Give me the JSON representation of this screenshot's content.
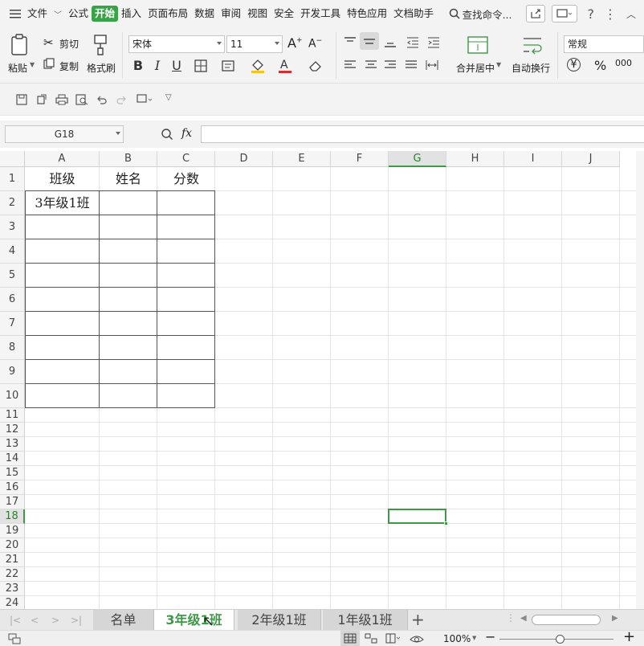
{
  "menu": {
    "items": [
      "文件",
      "公式",
      "开始",
      "插入",
      "页面布局",
      "数据",
      "审阅",
      "视图",
      "安全",
      "开发工具",
      "特色应用",
      "文档助手"
    ],
    "active": "开始",
    "search": "查找命令...",
    "help": "?"
  },
  "ribbon": {
    "paste": "粘贴",
    "cut": "剪切",
    "copy": "复制",
    "format_painter": "格式刷",
    "font_name": "宋体",
    "font_size": "11",
    "merge_center": "合并居中",
    "wrap_text": "自动换行",
    "number_format": "常规",
    "currency": "¥",
    "percent": "%",
    "thousands": "000"
  },
  "formula_bar": {
    "name_box": "G18",
    "fx": "fx"
  },
  "chart_data": {
    "type": "table",
    "columns": [
      "A",
      "B",
      "C",
      "D",
      "E",
      "F",
      "G",
      "H",
      "I",
      "J"
    ],
    "rows": [
      "1",
      "2",
      "3",
      "4",
      "5",
      "6",
      "7",
      "8",
      "9",
      "10",
      "11",
      "12",
      "13",
      "14",
      "15",
      "16",
      "17",
      "18",
      "19",
      "20",
      "21",
      "22",
      "23",
      "24"
    ],
    "selected_column": "G",
    "selected_row": "18",
    "cells": {
      "A1": "班级",
      "B1": "姓名",
      "C1": "分数",
      "A2": "3年级1班"
    }
  },
  "sheet_tabs": [
    "名单",
    "3年级1班",
    "2年级1班",
    "1年级1班"
  ],
  "active_tab": "3年级1班",
  "status": {
    "zoom": "100%"
  }
}
